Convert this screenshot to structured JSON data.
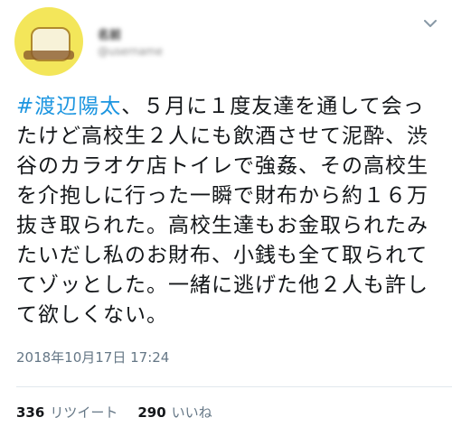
{
  "user": {
    "display_name": "名前",
    "handle": "@username"
  },
  "tweet": {
    "hashtag": "#渡辺陽太",
    "body": "、５月に１度友達を通して会ったけど高校生２人にも飲酒させて泥酔、渋谷のカラオケ店トイレで強姦、その高校生を介抱しに行った一瞬で財布から約１６万抜き取られた。高校生達もお金取られたみたいだし私のお財布、小銭も全て取られててゾッとした。一緒に逃げた他２人も許して欲しくない。",
    "timestamp": "2018年10月17日 17:24"
  },
  "stats": {
    "retweets": "336",
    "retweets_label": "リツイート",
    "likes": "290",
    "likes_label": "いいね"
  },
  "icons": {
    "caret": "chevron-down-icon"
  },
  "colors": {
    "hashtag": "#1b95e0",
    "meta": "#657786",
    "avatar_bg": "#f3e65a"
  }
}
